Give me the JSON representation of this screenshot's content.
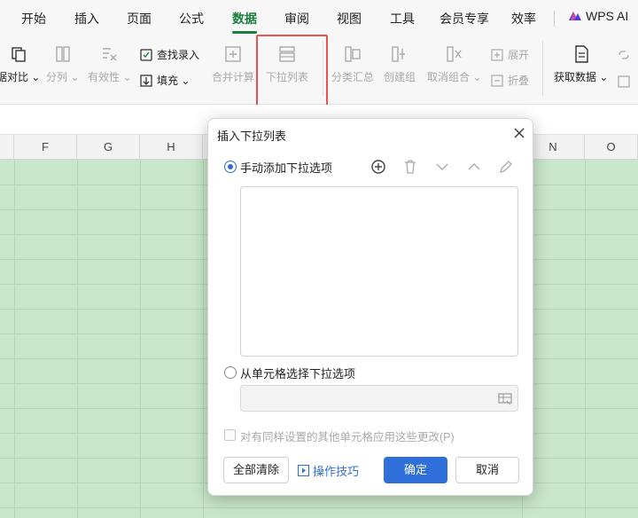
{
  "menu": {
    "tabs": [
      "开始",
      "插入",
      "页面",
      "公式",
      "数据",
      "审阅",
      "视图",
      "工具",
      "会员专享",
      "效率"
    ],
    "active_tab": "数据",
    "wps_ai": "WPS AI"
  },
  "ribbon": {
    "compare": "据对比",
    "split": "分列",
    "validity": "有效性",
    "find_entry": "查找录入",
    "fill": "填充",
    "merge_calc": "合并计算",
    "dropdown_list": "下拉列表",
    "subtotal": "分类汇总",
    "create_group": "创建组",
    "ungroup": "取消组合",
    "expand": "展开",
    "collapse": "折叠",
    "get_data": "获取数据"
  },
  "sheet": {
    "columns": [
      "F",
      "G",
      "H",
      "N",
      "O"
    ]
  },
  "dialog": {
    "title": "插入下拉列表",
    "option_manual": "手动添加下拉选项",
    "option_from_cells": "从单元格选择下拉选项",
    "apply_checkbox": "对有同样设置的其他单元格应用这些更改(P)",
    "clear_all": "全部清除",
    "tips": "操作技巧",
    "ok": "确定",
    "cancel": "取消"
  },
  "colors": {
    "accent_green": "#1a7f3c",
    "highlight_red": "#e8534f",
    "primary_blue": "#2f6fd9",
    "sheet_green": "#c8e6c9"
  }
}
